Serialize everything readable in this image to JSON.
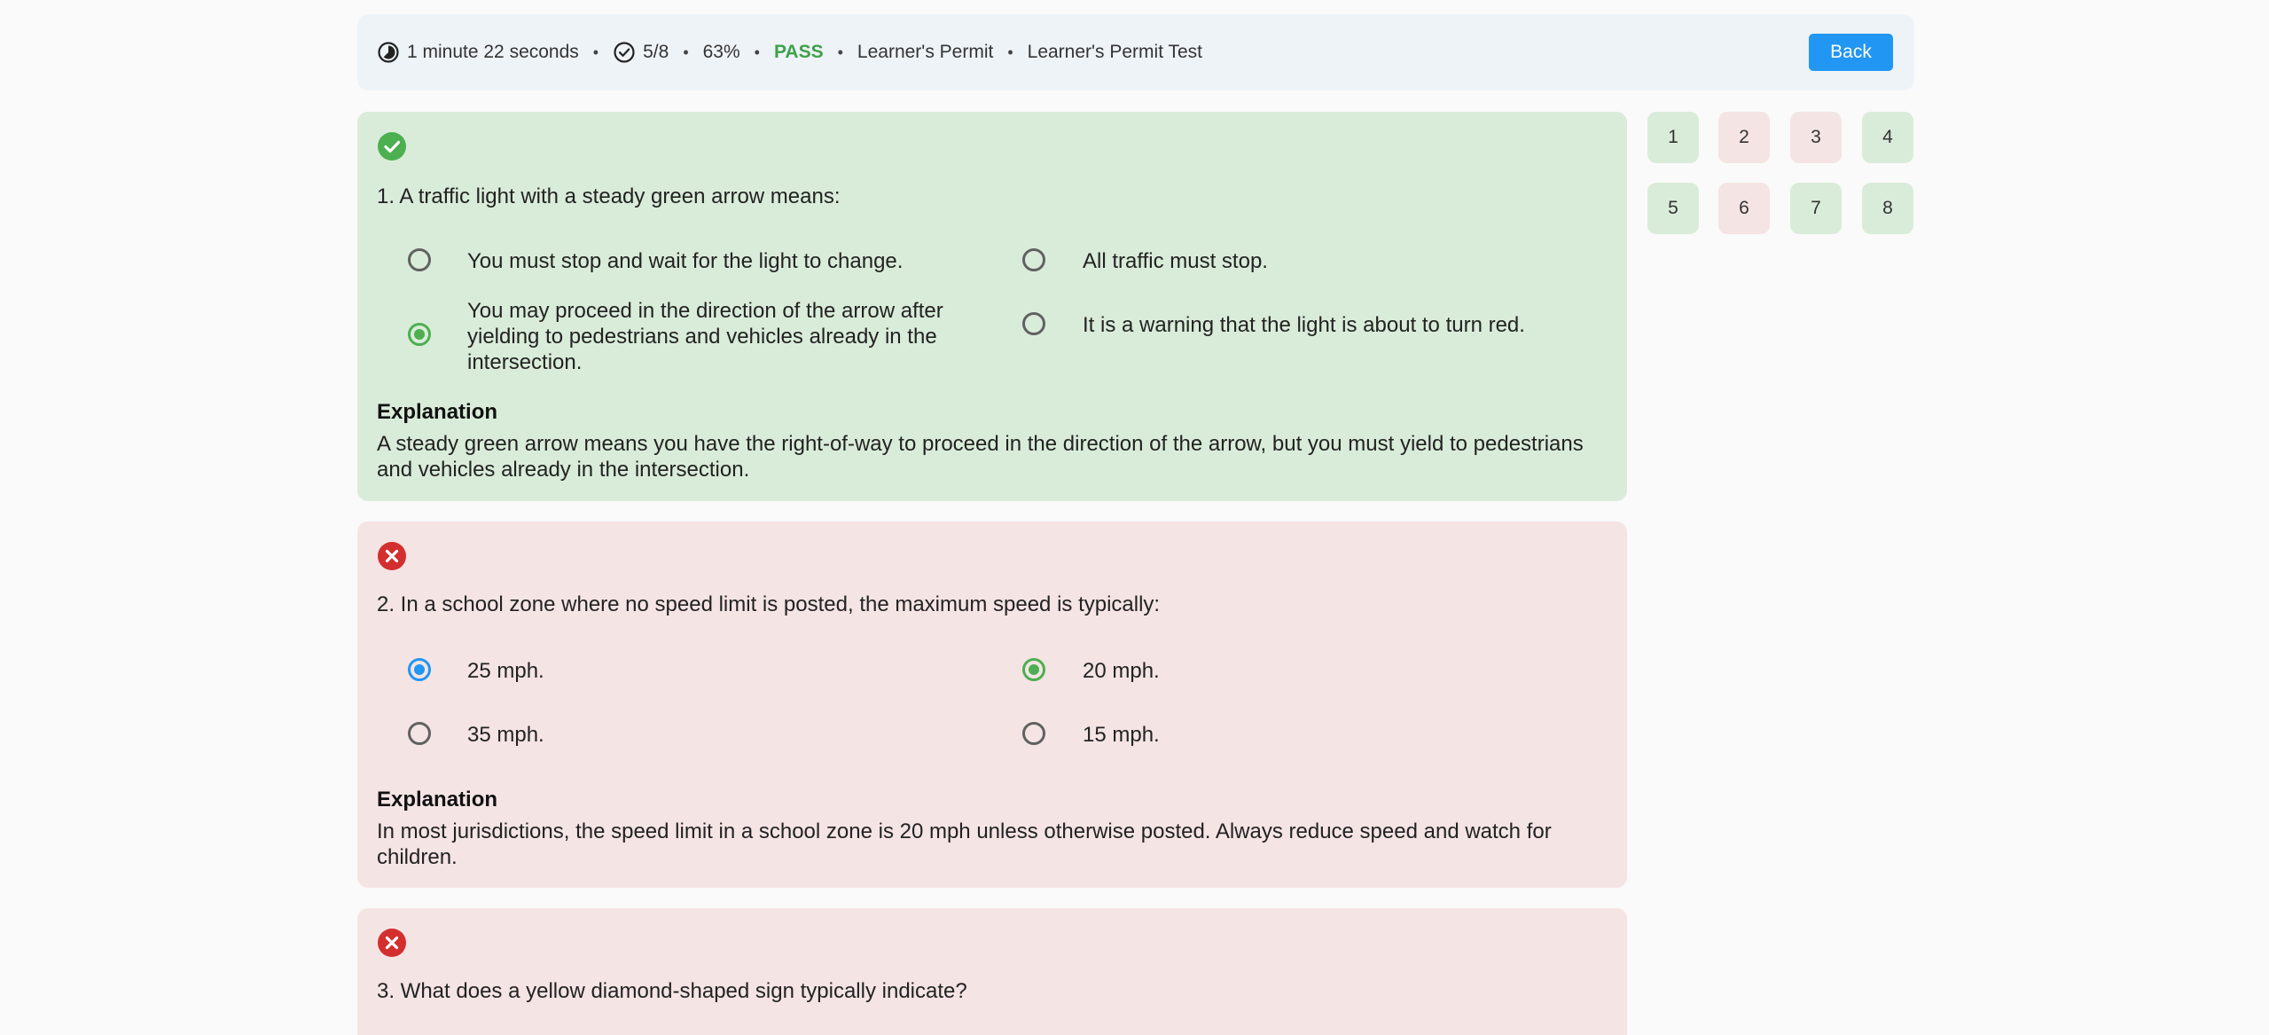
{
  "header": {
    "time": "1 minute 22 seconds",
    "score": "5/8",
    "percent": "63%",
    "result": "PASS",
    "category": "Learner's Permit",
    "test_name": "Learner's Permit Test",
    "separator": "•",
    "back_label": "Back",
    "colors": {
      "pass": "#3fa04a",
      "back_button": "#2196f3",
      "background": "#eef3f8"
    }
  },
  "questions": [
    {
      "status": "correct",
      "text": "1. A traffic light with a steady green arrow means:",
      "options": [
        {
          "label": "You must stop and wait for the light to change.",
          "state": "unselected"
        },
        {
          "label": "All traffic must stop.",
          "state": "unselected"
        },
        {
          "label": "You may proceed in the direction of the arrow after yielding to pedestrians and vehicles already in the intersection.",
          "state": "correct-answer"
        },
        {
          "label": "It is a warning that the light is about to turn red.",
          "state": "unselected"
        }
      ],
      "explanation_title": "Explanation",
      "explanation": "A steady green arrow means you have the right-of-way to proceed in the direction of the arrow, but you must yield to pedestrians and vehicles already in the intersection."
    },
    {
      "status": "wrong",
      "text": "2. In a school zone where no speed limit is posted, the maximum speed is typically:",
      "options": [
        {
          "label": "25 mph.",
          "state": "user-selected"
        },
        {
          "label": "20 mph.",
          "state": "correct-answer"
        },
        {
          "label": "35 mph.",
          "state": "unselected"
        },
        {
          "label": "15 mph.",
          "state": "unselected"
        }
      ],
      "explanation_title": "Explanation",
      "explanation": "In most jurisdictions, the speed limit in a school zone is 20 mph unless otherwise posted. Always reduce speed and watch for children."
    },
    {
      "status": "wrong",
      "text": "3. What does a yellow diamond-shaped sign typically indicate?"
    }
  ],
  "navigator": [
    {
      "label": "1",
      "status": "correct"
    },
    {
      "label": "2",
      "status": "wrong"
    },
    {
      "label": "3",
      "status": "wrong"
    },
    {
      "label": "4",
      "status": "correct"
    },
    {
      "label": "5",
      "status": "correct"
    },
    {
      "label": "6",
      "status": "wrong"
    },
    {
      "label": "7",
      "status": "correct"
    },
    {
      "label": "8",
      "status": "correct"
    }
  ],
  "icons": {
    "timer": "timer-icon",
    "score": "check-circle-icon",
    "correct": "check-circle-filled-icon",
    "wrong": "x-circle-filled-icon"
  },
  "colors": {
    "correct_bg": "#d9ecd9",
    "wrong_bg": "#f5e4e4",
    "correct_icon": "#4caf50",
    "wrong_icon": "#d32f2f",
    "selected_radio": "#2196f3"
  }
}
